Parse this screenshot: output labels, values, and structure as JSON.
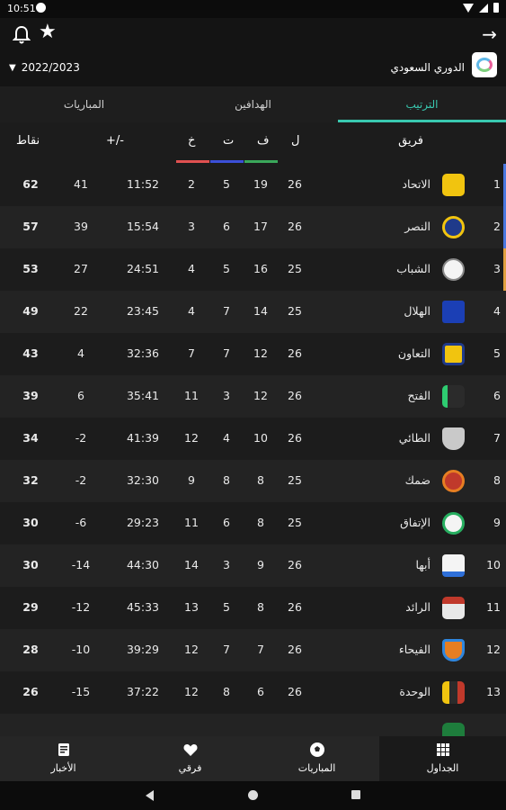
{
  "status": {
    "time": "10:51"
  },
  "header": {
    "season": "2022/2023",
    "league_name": "الدوري السعودي"
  },
  "tabs": [
    "المباريات",
    "الهدافين",
    "الترتيب"
  ],
  "columns": {
    "team": "فريق",
    "played": "ل",
    "won": "ف",
    "draw": "ت",
    "lost": "خ",
    "goals": "+/-",
    "points": "نقاط"
  },
  "colors": {
    "accent": "#39c9b0",
    "won": "#3aa85a",
    "draw": "#3b4fd8",
    "lost": "#e05050",
    "bar_blue": "#4a78e0",
    "bar_orange": "#e0a040"
  },
  "standings": [
    {
      "rank": "1",
      "team": "الاتحاد",
      "p": "26",
      "w": "19",
      "d": "5",
      "l": "2",
      "goals": "11:52",
      "gd": "41",
      "pts": "62"
    },
    {
      "rank": "2",
      "team": "النصر",
      "p": "26",
      "w": "17",
      "d": "6",
      "l": "3",
      "goals": "15:54",
      "gd": "39",
      "pts": "57"
    },
    {
      "rank": "3",
      "team": "الشباب",
      "p": "25",
      "w": "16",
      "d": "5",
      "l": "4",
      "goals": "24:51",
      "gd": "27",
      "pts": "53"
    },
    {
      "rank": "4",
      "team": "الهلال",
      "p": "25",
      "w": "14",
      "d": "7",
      "l": "4",
      "goals": "23:45",
      "gd": "22",
      "pts": "49"
    },
    {
      "rank": "5",
      "team": "التعاون",
      "p": "26",
      "w": "12",
      "d": "7",
      "l": "7",
      "goals": "32:36",
      "gd": "4",
      "pts": "43"
    },
    {
      "rank": "6",
      "team": "الفتح",
      "p": "26",
      "w": "12",
      "d": "3",
      "l": "11",
      "goals": "35:41",
      "gd": "6",
      "pts": "39"
    },
    {
      "rank": "7",
      "team": "الطائي",
      "p": "26",
      "w": "10",
      "d": "4",
      "l": "12",
      "goals": "41:39",
      "gd": "-2",
      "pts": "34"
    },
    {
      "rank": "8",
      "team": "ضمك",
      "p": "25",
      "w": "8",
      "d": "8",
      "l": "9",
      "goals": "32:30",
      "gd": "-2",
      "pts": "32"
    },
    {
      "rank": "9",
      "team": "الإتفاق",
      "p": "25",
      "w": "8",
      "d": "6",
      "l": "11",
      "goals": "29:23",
      "gd": "-6",
      "pts": "30"
    },
    {
      "rank": "10",
      "team": "أبها",
      "p": "26",
      "w": "9",
      "d": "3",
      "l": "14",
      "goals": "44:30",
      "gd": "-14",
      "pts": "30"
    },
    {
      "rank": "11",
      "team": "الرائد",
      "p": "26",
      "w": "8",
      "d": "5",
      "l": "13",
      "goals": "45:33",
      "gd": "-12",
      "pts": "29"
    },
    {
      "rank": "12",
      "team": "الفيحاء",
      "p": "26",
      "w": "7",
      "d": "7",
      "l": "12",
      "goals": "39:29",
      "gd": "-10",
      "pts": "28"
    },
    {
      "rank": "13",
      "team": "الوحدة",
      "p": "26",
      "w": "6",
      "d": "8",
      "l": "12",
      "goals": "37:22",
      "gd": "-15",
      "pts": "26"
    }
  ],
  "bottom_nav": [
    "الأخبار",
    "فرقي",
    "المباريات",
    "الجداول"
  ]
}
